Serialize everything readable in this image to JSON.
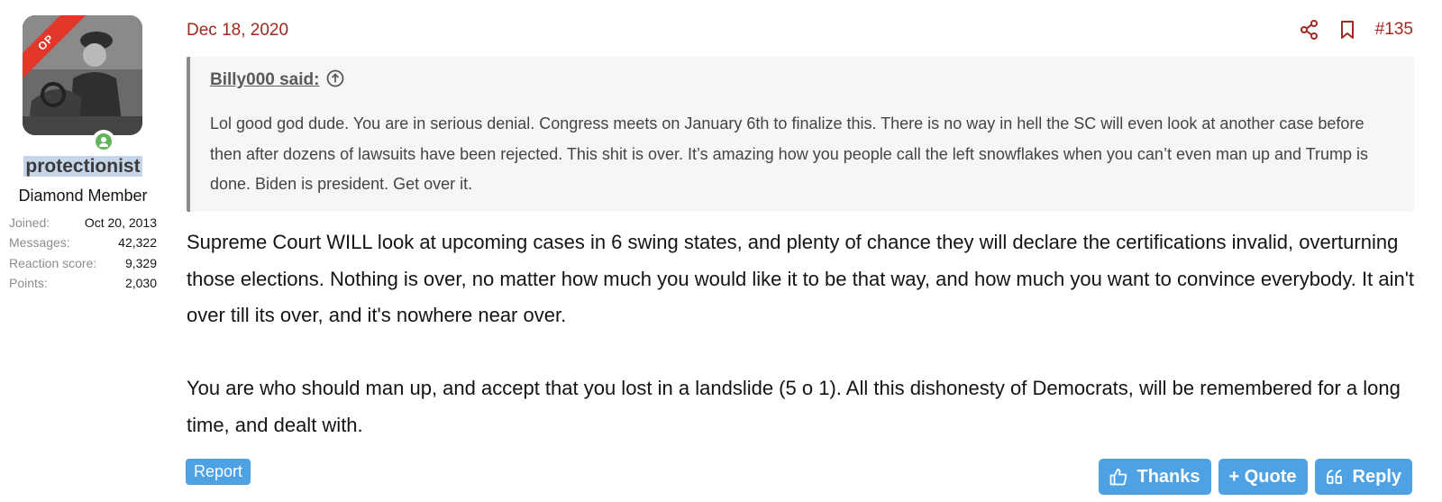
{
  "user": {
    "ribbon": "OP",
    "username": "protectionist",
    "title": "Diamond Member",
    "stats": [
      {
        "label": "Joined:",
        "value": "Oct 20, 2013"
      },
      {
        "label": "Messages:",
        "value": "42,322"
      },
      {
        "label": "Reaction score:",
        "value": "9,329"
      },
      {
        "label": "Points:",
        "value": "2,030"
      }
    ]
  },
  "post": {
    "date": "Dec 18, 2020",
    "number": "#135",
    "quote": {
      "author": "Billy000 said:",
      "text": "Lol good god dude. You are in serious denial. Congress meets on January 6th to finalize this. There is no way in hell the SC will even look at another case before then after dozens of lawsuits have been rejected. This shit is over. It’s amazing how you people call the left snowflakes when you can’t even man up and Trump is done. Biden is president. Get over it."
    },
    "paragraphs": [
      "Supreme Court WILL look at upcoming cases in 6 swing states, and plenty of chance they will declare the certifications invalid, overturning those elections. Nothing is over, no matter how much you would like it to be that way, and how much you want to convince everybody. It ain't over till its over, and it's nowhere near over.",
      "You are who should man up, and accept that you lost in a landslide (5 o 1). All this dishonesty of Democrats, will be remembered for a long time, and dealt with."
    ]
  },
  "actions": {
    "report": "Report",
    "thanks": "Thanks",
    "quote": "+ Quote",
    "reply": "Reply"
  },
  "colors": {
    "accent_red": "#a3281e",
    "button_blue": "#4ea1e3",
    "online_green": "#63b35c"
  }
}
